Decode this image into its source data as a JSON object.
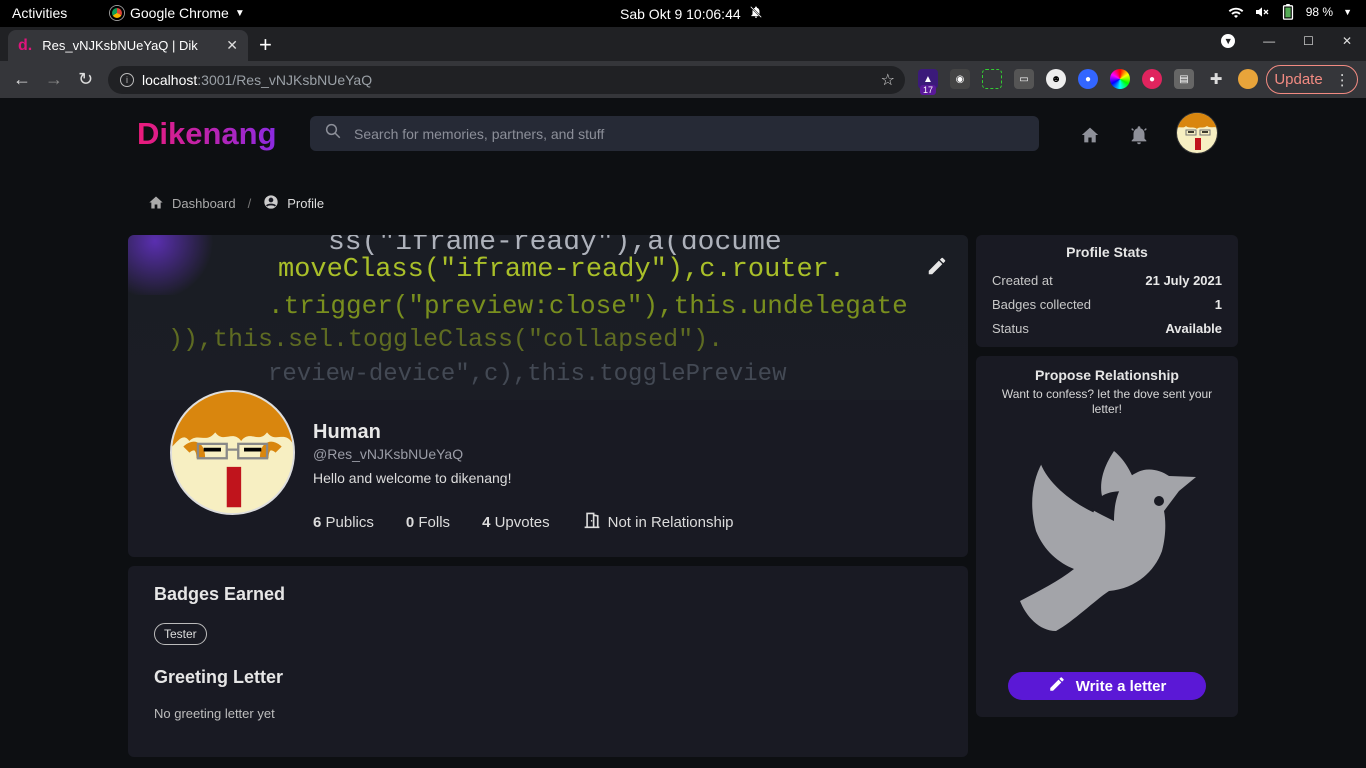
{
  "gnome": {
    "activities": "Activities",
    "app": "Google Chrome",
    "clock": "Sab Okt 9  10:06:44",
    "battery": "98 %"
  },
  "chrome": {
    "tab_title": "Res_vNJKsbNUeYaQ | Dik",
    "url_host": "localhost",
    "url_path": ":3001/Res_vNJKsbNUeYaQ",
    "ext_badge": "17",
    "update_label": "Update"
  },
  "site": {
    "brand": "Dikenang",
    "search_placeholder": "Search for memories, partners, and stuff"
  },
  "breadcrumb": {
    "home": "Dashboard",
    "separator": "/",
    "current": "Profile"
  },
  "cover_code": [
    "ss(\"iframe-ready\"),a(docume",
    "moveClass(\"iframe-ready\"),c.router.",
    ".trigger(\"preview:close\"),this.undelegate",
    ")),this.sel.toggleClass(\"collapsed\").",
    "review-device\",c),this.togglePreview"
  ],
  "profile": {
    "name": "Human",
    "handle": "@Res_vNJKsbNUeYaQ",
    "bio": "Hello and welcome to dikenang!",
    "stats": {
      "publics_count": "6",
      "publics_label": "Publics",
      "folls_count": "0",
      "folls_label": "Folls",
      "upvotes_count": "4",
      "upvotes_label": "Upvotes",
      "relationship": "Not in Relationship"
    }
  },
  "badges": {
    "title": "Badges Earned",
    "items": [
      "Tester"
    ]
  },
  "greeting": {
    "title": "Greeting Letter",
    "empty_text": "No greeting letter yet"
  },
  "profile_stats": {
    "title": "Profile Stats",
    "rows": [
      {
        "label": "Created at",
        "value": "21 July 2021"
      },
      {
        "label": "Badges collected",
        "value": "1"
      },
      {
        "label": "Status",
        "value": "Available"
      }
    ]
  },
  "propose": {
    "title": "Propose Relationship",
    "subtitle": "Want to confess? let the dove sent your letter!",
    "button": "Write a letter"
  },
  "colors": {
    "brand_start": "#ec1b7a",
    "brand_end": "#8a2be2",
    "accent_button": "#5b18d6",
    "card_bg": "#191a23",
    "page_bg": "#0d0f12"
  }
}
